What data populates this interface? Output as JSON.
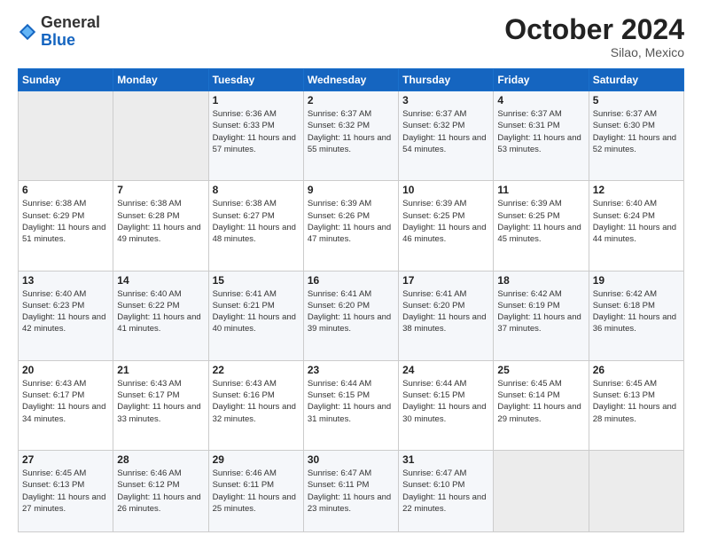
{
  "header": {
    "logo_general": "General",
    "logo_blue": "Blue",
    "month_title": "October 2024",
    "location": "Silao, Mexico"
  },
  "days_of_week": [
    "Sunday",
    "Monday",
    "Tuesday",
    "Wednesday",
    "Thursday",
    "Friday",
    "Saturday"
  ],
  "weeks": [
    [
      {
        "day": "",
        "info": ""
      },
      {
        "day": "",
        "info": ""
      },
      {
        "day": "1",
        "info": "Sunrise: 6:36 AM\nSunset: 6:33 PM\nDaylight: 11 hours and 57 minutes."
      },
      {
        "day": "2",
        "info": "Sunrise: 6:37 AM\nSunset: 6:32 PM\nDaylight: 11 hours and 55 minutes."
      },
      {
        "day": "3",
        "info": "Sunrise: 6:37 AM\nSunset: 6:32 PM\nDaylight: 11 hours and 54 minutes."
      },
      {
        "day": "4",
        "info": "Sunrise: 6:37 AM\nSunset: 6:31 PM\nDaylight: 11 hours and 53 minutes."
      },
      {
        "day": "5",
        "info": "Sunrise: 6:37 AM\nSunset: 6:30 PM\nDaylight: 11 hours and 52 minutes."
      }
    ],
    [
      {
        "day": "6",
        "info": "Sunrise: 6:38 AM\nSunset: 6:29 PM\nDaylight: 11 hours and 51 minutes."
      },
      {
        "day": "7",
        "info": "Sunrise: 6:38 AM\nSunset: 6:28 PM\nDaylight: 11 hours and 49 minutes."
      },
      {
        "day": "8",
        "info": "Sunrise: 6:38 AM\nSunset: 6:27 PM\nDaylight: 11 hours and 48 minutes."
      },
      {
        "day": "9",
        "info": "Sunrise: 6:39 AM\nSunset: 6:26 PM\nDaylight: 11 hours and 47 minutes."
      },
      {
        "day": "10",
        "info": "Sunrise: 6:39 AM\nSunset: 6:25 PM\nDaylight: 11 hours and 46 minutes."
      },
      {
        "day": "11",
        "info": "Sunrise: 6:39 AM\nSunset: 6:25 PM\nDaylight: 11 hours and 45 minutes."
      },
      {
        "day": "12",
        "info": "Sunrise: 6:40 AM\nSunset: 6:24 PM\nDaylight: 11 hours and 44 minutes."
      }
    ],
    [
      {
        "day": "13",
        "info": "Sunrise: 6:40 AM\nSunset: 6:23 PM\nDaylight: 11 hours and 42 minutes."
      },
      {
        "day": "14",
        "info": "Sunrise: 6:40 AM\nSunset: 6:22 PM\nDaylight: 11 hours and 41 minutes."
      },
      {
        "day": "15",
        "info": "Sunrise: 6:41 AM\nSunset: 6:21 PM\nDaylight: 11 hours and 40 minutes."
      },
      {
        "day": "16",
        "info": "Sunrise: 6:41 AM\nSunset: 6:20 PM\nDaylight: 11 hours and 39 minutes."
      },
      {
        "day": "17",
        "info": "Sunrise: 6:41 AM\nSunset: 6:20 PM\nDaylight: 11 hours and 38 minutes."
      },
      {
        "day": "18",
        "info": "Sunrise: 6:42 AM\nSunset: 6:19 PM\nDaylight: 11 hours and 37 minutes."
      },
      {
        "day": "19",
        "info": "Sunrise: 6:42 AM\nSunset: 6:18 PM\nDaylight: 11 hours and 36 minutes."
      }
    ],
    [
      {
        "day": "20",
        "info": "Sunrise: 6:43 AM\nSunset: 6:17 PM\nDaylight: 11 hours and 34 minutes."
      },
      {
        "day": "21",
        "info": "Sunrise: 6:43 AM\nSunset: 6:17 PM\nDaylight: 11 hours and 33 minutes."
      },
      {
        "day": "22",
        "info": "Sunrise: 6:43 AM\nSunset: 6:16 PM\nDaylight: 11 hours and 32 minutes."
      },
      {
        "day": "23",
        "info": "Sunrise: 6:44 AM\nSunset: 6:15 PM\nDaylight: 11 hours and 31 minutes."
      },
      {
        "day": "24",
        "info": "Sunrise: 6:44 AM\nSunset: 6:15 PM\nDaylight: 11 hours and 30 minutes."
      },
      {
        "day": "25",
        "info": "Sunrise: 6:45 AM\nSunset: 6:14 PM\nDaylight: 11 hours and 29 minutes."
      },
      {
        "day": "26",
        "info": "Sunrise: 6:45 AM\nSunset: 6:13 PM\nDaylight: 11 hours and 28 minutes."
      }
    ],
    [
      {
        "day": "27",
        "info": "Sunrise: 6:45 AM\nSunset: 6:13 PM\nDaylight: 11 hours and 27 minutes."
      },
      {
        "day": "28",
        "info": "Sunrise: 6:46 AM\nSunset: 6:12 PM\nDaylight: 11 hours and 26 minutes."
      },
      {
        "day": "29",
        "info": "Sunrise: 6:46 AM\nSunset: 6:11 PM\nDaylight: 11 hours and 25 minutes."
      },
      {
        "day": "30",
        "info": "Sunrise: 6:47 AM\nSunset: 6:11 PM\nDaylight: 11 hours and 23 minutes."
      },
      {
        "day": "31",
        "info": "Sunrise: 6:47 AM\nSunset: 6:10 PM\nDaylight: 11 hours and 22 minutes."
      },
      {
        "day": "",
        "info": ""
      },
      {
        "day": "",
        "info": ""
      }
    ]
  ]
}
